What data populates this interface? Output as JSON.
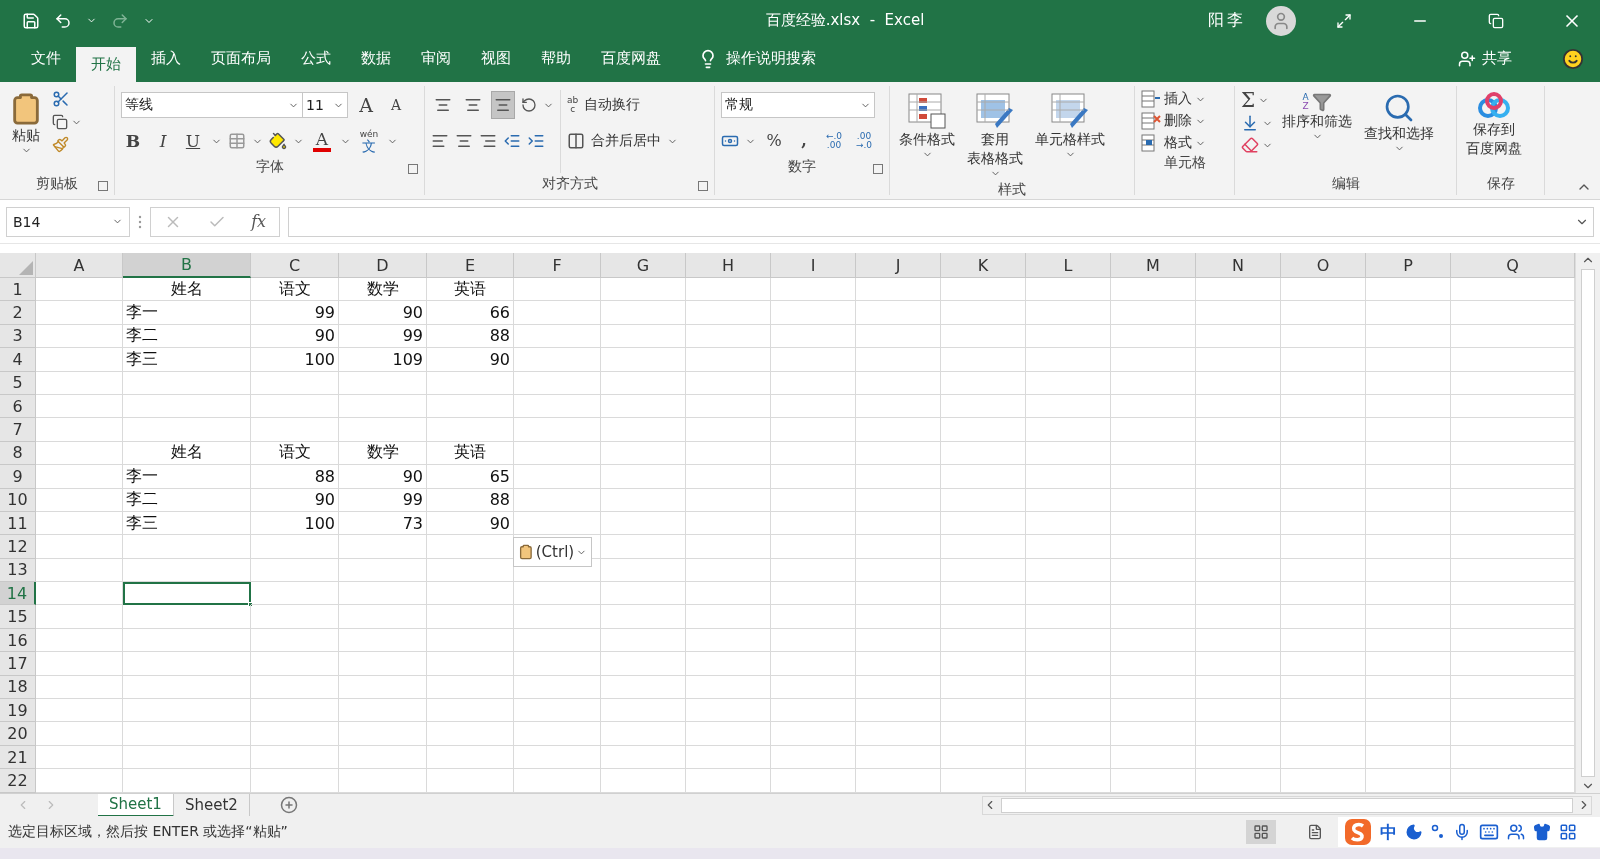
{
  "window": {
    "title": "百度经验.xlsx  -  Excel",
    "user": "阳李"
  },
  "menu_tabs": [
    {
      "label": "文件",
      "selected": false
    },
    {
      "label": "开始",
      "selected": true
    },
    {
      "label": "插入",
      "selected": false
    },
    {
      "label": "页面布局",
      "selected": false
    },
    {
      "label": "公式",
      "selected": false
    },
    {
      "label": "数据",
      "selected": false
    },
    {
      "label": "审阅",
      "selected": false
    },
    {
      "label": "视图",
      "selected": false
    },
    {
      "label": "帮助",
      "selected": false
    },
    {
      "label": "百度网盘",
      "selected": false
    }
  ],
  "tell_me": "操作说明搜索",
  "share": "共享",
  "ribbon": {
    "clipboard": {
      "label": "剪贴板",
      "paste": "粘贴"
    },
    "font": {
      "label": "字体",
      "font_name": "等线",
      "font_size": "11",
      "grow": "A",
      "shrink": "A",
      "bold": "B",
      "italic": "I",
      "underline": "U",
      "font_color": "A",
      "phonetic_ruby": "wén",
      "phonetic_base": "文"
    },
    "alignment": {
      "label": "对齐方式",
      "wrap_icon_top": "ab",
      "wrap_icon_bottom": "c",
      "wrap_text": "自动换行",
      "merge": "合并后居中"
    },
    "number": {
      "label": "数字",
      "format": "常规",
      "percent": "%",
      "comma": ",",
      "increase_decimal": [
        "←.0",
        ".00"
      ],
      "decrease_decimal": [
        ".00",
        "→.0"
      ]
    },
    "styles": {
      "label": "样式",
      "buttons": [
        {
          "lines": [
            "条件格式"
          ],
          "kind": "conditional"
        },
        {
          "lines": [
            "套用",
            "表格格式"
          ],
          "kind": "table"
        },
        {
          "lines": [
            "单元格样式"
          ],
          "kind": "cell"
        }
      ]
    },
    "cells": {
      "label": "单元格",
      "buttons": [
        {
          "label": "插入",
          "kind": "insert"
        },
        {
          "label": "删除",
          "kind": "delete"
        },
        {
          "label": "格式",
          "kind": "format"
        }
      ]
    },
    "editing": {
      "label": "编辑",
      "sum": "Σ",
      "sort_letters": [
        "A",
        "Z"
      ],
      "sort": "排序和筛选",
      "find": "查找和选择"
    },
    "save": {
      "label": "保存",
      "lines": [
        "保存到",
        "百度网盘"
      ]
    }
  },
  "formula_bar": {
    "name_box": "B14",
    "fx": "fx"
  },
  "columns": [
    {
      "label": "A",
      "selected": false
    },
    {
      "label": "B",
      "selected": true
    },
    {
      "label": "C",
      "selected": false
    },
    {
      "label": "D",
      "selected": false
    },
    {
      "label": "E",
      "selected": false
    },
    {
      "label": "F",
      "selected": false
    },
    {
      "label": "G",
      "selected": false
    },
    {
      "label": "H",
      "selected": false
    },
    {
      "label": "I",
      "selected": false
    },
    {
      "label": "J",
      "selected": false
    },
    {
      "label": "K",
      "selected": false
    },
    {
      "label": "L",
      "selected": false
    },
    {
      "label": "M",
      "selected": false
    },
    {
      "label": "N",
      "selected": false
    },
    {
      "label": "O",
      "selected": false
    },
    {
      "label": "P",
      "selected": false
    },
    {
      "label": "Q",
      "selected": false
    }
  ],
  "rows": [
    {
      "number": "1",
      "selected": false,
      "cells": [
        null,
        {
          "text": "姓名",
          "kind": "header"
        },
        {
          "text": "语文",
          "kind": "header"
        },
        {
          "text": "数学",
          "kind": "header"
        },
        {
          "text": "英语",
          "kind": "header"
        }
      ]
    },
    {
      "number": "2",
      "selected": false,
      "cells": [
        null,
        {
          "text": "李一",
          "kind": "name"
        },
        {
          "text": "99",
          "kind": "number"
        },
        {
          "text": "90",
          "kind": "number"
        },
        {
          "text": "66",
          "kind": "number"
        }
      ]
    },
    {
      "number": "3",
      "selected": false,
      "cells": [
        null,
        {
          "text": "李二",
          "kind": "name"
        },
        {
          "text": "90",
          "kind": "number"
        },
        {
          "text": "99",
          "kind": "number"
        },
        {
          "text": "88",
          "kind": "number"
        }
      ]
    },
    {
      "number": "4",
      "selected": false,
      "cells": [
        null,
        {
          "text": "李三",
          "kind": "name"
        },
        {
          "text": "100",
          "kind": "number"
        },
        {
          "text": "109",
          "kind": "number"
        },
        {
          "text": "90",
          "kind": "number"
        }
      ]
    },
    {
      "number": "5",
      "selected": false,
      "cells": []
    },
    {
      "number": "6",
      "selected": false,
      "cells": []
    },
    {
      "number": "7",
      "selected": false,
      "cells": []
    },
    {
      "number": "8",
      "selected": false,
      "cells": [
        null,
        {
          "text": "姓名",
          "kind": "header"
        },
        {
          "text": "语文",
          "kind": "header"
        },
        {
          "text": "数学",
          "kind": "header"
        },
        {
          "text": "英语",
          "kind": "header"
        }
      ]
    },
    {
      "number": "9",
      "selected": false,
      "cells": [
        null,
        {
          "text": "李一",
          "kind": "name"
        },
        {
          "text": "88",
          "kind": "number"
        },
        {
          "text": "90",
          "kind": "number"
        },
        {
          "text": "65",
          "kind": "number"
        }
      ]
    },
    {
      "number": "10",
      "selected": false,
      "cells": [
        null,
        {
          "text": "李二",
          "kind": "name"
        },
        {
          "text": "90",
          "kind": "number"
        },
        {
          "text": "99",
          "kind": "number"
        },
        {
          "text": "88",
          "kind": "number"
        }
      ]
    },
    {
      "number": "11",
      "selected": false,
      "cells": [
        null,
        {
          "text": "李三",
          "kind": "name"
        },
        {
          "text": "100",
          "kind": "number"
        },
        {
          "text": "73",
          "kind": "number"
        },
        {
          "text": "90",
          "kind": "number"
        }
      ]
    },
    {
      "number": "12",
      "selected": false,
      "cells": []
    },
    {
      "number": "13",
      "selected": false,
      "cells": []
    },
    {
      "number": "14",
      "selected": true,
      "cells": [
        null,
        {
          "active": true
        }
      ]
    },
    {
      "number": "15",
      "selected": false,
      "cells": []
    },
    {
      "number": "16",
      "selected": false,
      "cells": []
    },
    {
      "number": "17",
      "selected": false,
      "cells": []
    },
    {
      "number": "18",
      "selected": false,
      "cells": []
    },
    {
      "number": "19",
      "selected": false,
      "cells": []
    },
    {
      "number": "20",
      "selected": false,
      "cells": []
    },
    {
      "number": "21",
      "selected": false,
      "cells": []
    },
    {
      "number": "22",
      "selected": false,
      "cells": []
    }
  ],
  "paste_options": "(Ctrl)",
  "sheets": [
    {
      "label": "Sheet1",
      "selected": true
    },
    {
      "label": "Sheet2",
      "selected": false
    }
  ],
  "status_bar": {
    "message": "选定目标区域，然后按 ENTER 或选择“粘贴”"
  },
  "ime_bar": {
    "mode": "中"
  }
}
